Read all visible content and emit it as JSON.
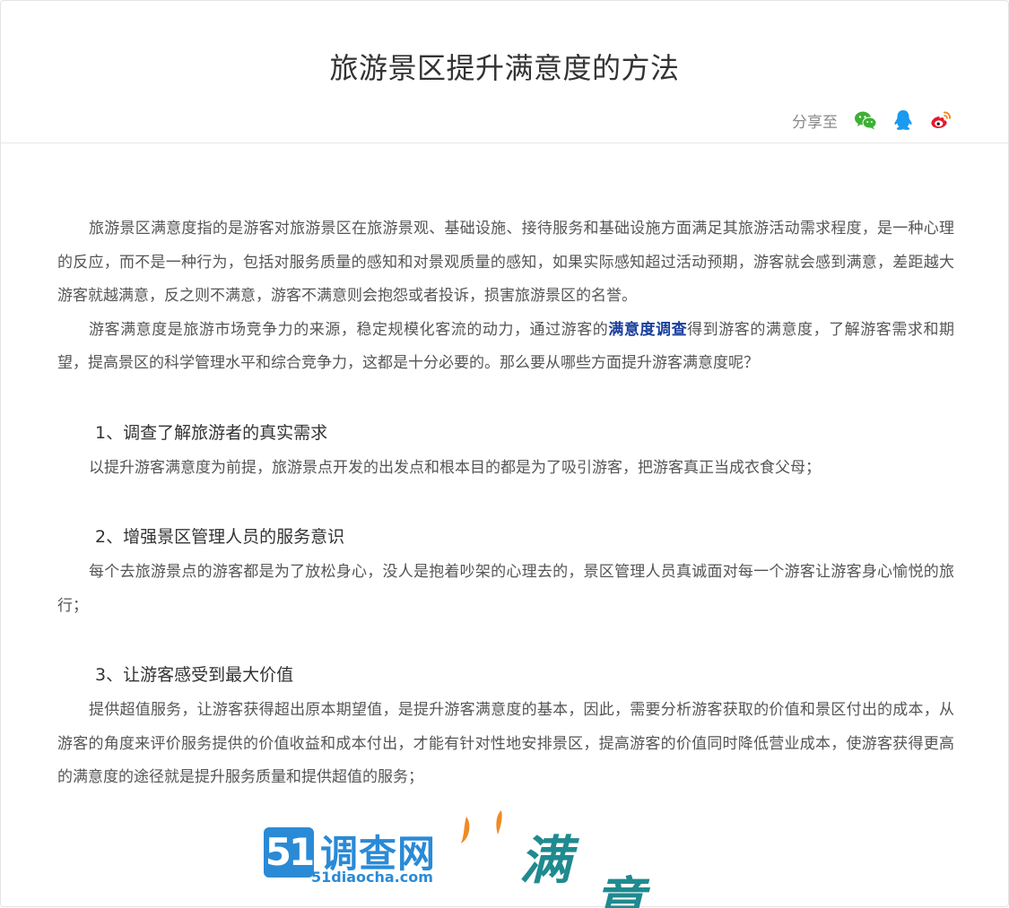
{
  "article": {
    "title": "旅游景区提升满意度的方法",
    "share_label": "分享至",
    "share_icons": [
      "wechat-icon",
      "qq-icon",
      "weibo-icon"
    ],
    "intro_1": "旅游景区满意度指的是游客对旅游景区在旅游景观、基础设施、接待服务和基础设施方面满足其旅游活动需求程度，是一种心理的反应，而不是一种行为，包括对服务质量的感知和对景观质量的感知，如果实际感知超过活动预期，游客就会感到满意，差距越大游客就越满意，反之则不满意，游客不满意则会抱怨或者投诉，损害旅游景区的名誉。",
    "intro_2_before": "游客满意度是旅游市场竞争力的来源，稳定规模化客流的动力，通过游客的",
    "intro_2_link": "满意度调查",
    "intro_2_after": "得到游客的满意度，了解游客需求和期望，提高景区的科学管理水平和综合竞争力，这都是十分必要的。那么要从哪些方面提升游客满意度呢？",
    "sections": [
      {
        "heading": "1、调查了解旅游者的真实需求",
        "body": "以提升游客满意度为前提，旅游景点开发的出发点和根本目的都是为了吸引游客，把游客真正当成衣食父母；"
      },
      {
        "heading": "2、增强景区管理人员的服务意识",
        "body": "每个去旅游景点的游客都是为了放松身心，没人是抱着吵架的心理去的，景区管理人员真诚面对每一个游客让游客身心愉悦的旅行；"
      },
      {
        "heading": "3、让游客感受到最大价值",
        "body": "提供超值服务，让游客获得超出原本期望值，是提升游客满意度的基本，因此，需要分析游客获取的价值和景区付出的成本，从游客的角度来评价服务提供的价值收益和成本付出，才能有针对性地安排景区，提高游客的价值同时降低营业成本，使游客获得更高的满意度的途径就是提升服务质量和提供超值的服务；"
      }
    ]
  },
  "banner": {
    "logo_number": "51",
    "logo_name": "调查网",
    "logo_url": "51diaocha.com",
    "art_char_1": "满",
    "art_char_2": "意"
  },
  "colors": {
    "link": "#1a3f9c",
    "brand_blue": "#2a8ad6",
    "wechat_green": "#3cb034",
    "qq_blue": "#1a9af0",
    "weibo_red": "#e6162d",
    "petal_orange": "#f08a24"
  }
}
